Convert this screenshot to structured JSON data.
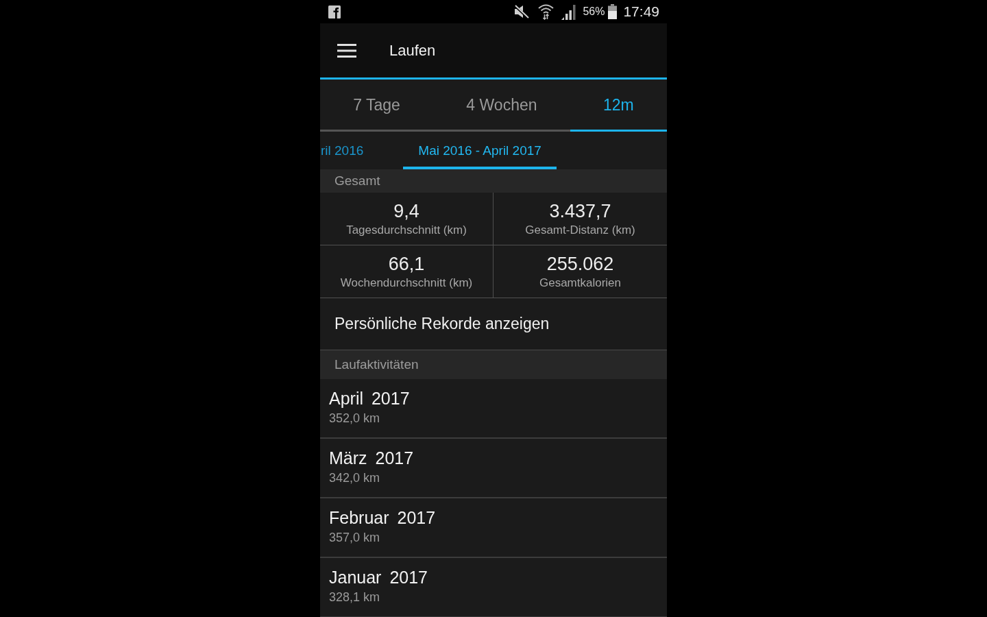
{
  "status_bar": {
    "battery_percent": "56%",
    "time": "17:49"
  },
  "app_bar": {
    "title": "Laufen"
  },
  "range_tabs": [
    {
      "label": "7 Tage",
      "selected": false
    },
    {
      "label": "4 Wochen",
      "selected": false
    },
    {
      "label": "12m",
      "selected": true
    }
  ],
  "period_tabs": [
    {
      "label": "ril 2016",
      "selected": false
    },
    {
      "label": "Mai 2016 - April 2017",
      "selected": true
    }
  ],
  "summary": {
    "heading": "Gesamt",
    "stats": [
      {
        "value": "9,4",
        "label": "Tagesdurchschnitt (km)"
      },
      {
        "value": "3.437,7",
        "label": "Gesamt-Distanz (km)"
      },
      {
        "value": "66,1",
        "label": "Wochendurchschnitt (km)"
      },
      {
        "value": "255.062",
        "label": "Gesamtkalorien"
      }
    ]
  },
  "records_link": "Persönliche Rekorde anzeigen",
  "activities": {
    "heading": "Laufaktivitäten",
    "items": [
      {
        "title": "April 2017",
        "distance": "352,0 km"
      },
      {
        "title": "März 2017",
        "distance": "342,0 km"
      },
      {
        "title": "Februar 2017",
        "distance": "357,0 km"
      },
      {
        "title": "Januar 2017",
        "distance": "328,1 km"
      }
    ]
  }
}
